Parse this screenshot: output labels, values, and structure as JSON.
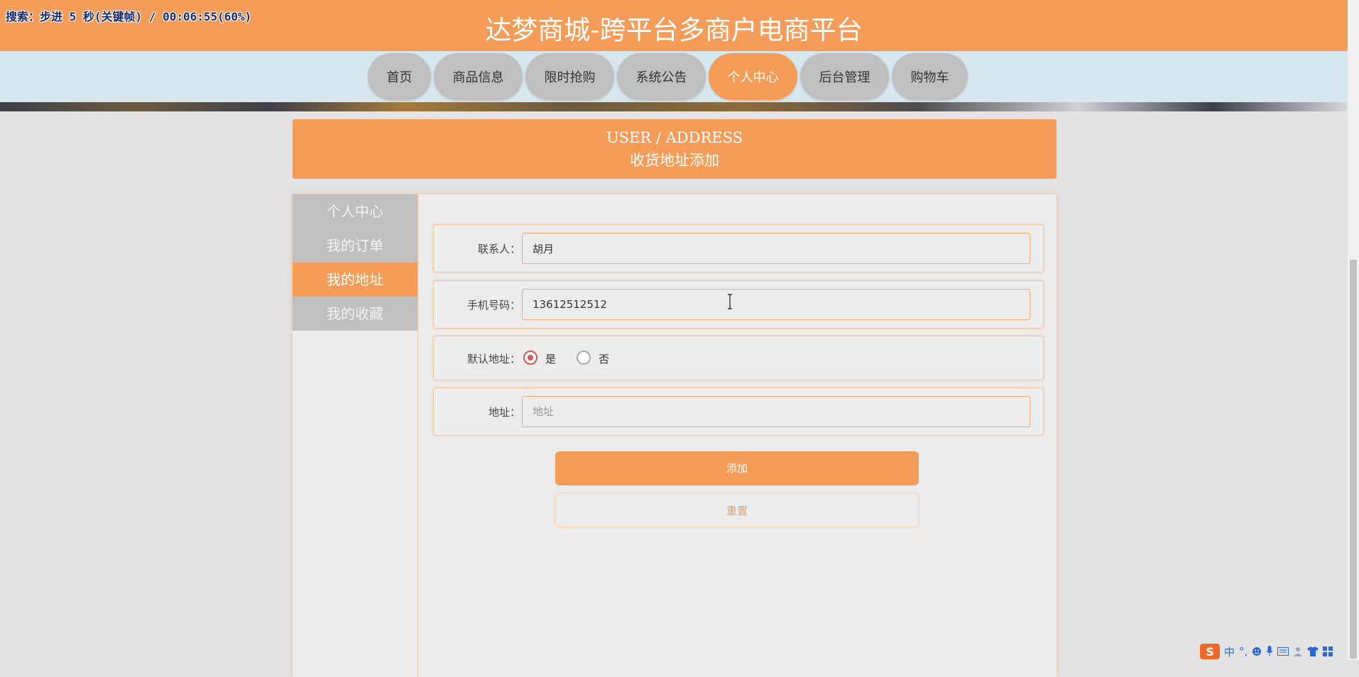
{
  "overlay": "搜索：步进 5 秒(关键帧) / 00:06:55(60%)",
  "header": {
    "title": "达梦商城-跨平台多商户电商平台"
  },
  "nav": [
    {
      "label": "首页",
      "active": false
    },
    {
      "label": "商品信息",
      "active": false
    },
    {
      "label": "限时抢购",
      "active": false
    },
    {
      "label": "系统公告",
      "active": false
    },
    {
      "label": "个人中心",
      "active": true
    },
    {
      "label": "后台管理",
      "active": false
    },
    {
      "label": "购物车",
      "active": false
    }
  ],
  "heading": {
    "en": "USER / ADDRESS",
    "cn": "收货地址添加"
  },
  "side_menu": [
    {
      "label": "个人中心",
      "active": false
    },
    {
      "label": "我的订单",
      "active": false
    },
    {
      "label": "我的地址",
      "active": true
    },
    {
      "label": "我的收藏",
      "active": false
    }
  ],
  "form": {
    "contact": {
      "label": "联系人：",
      "value": "胡月"
    },
    "phone": {
      "label": "手机号码：",
      "value": "13612512512"
    },
    "default": {
      "label": "默认地址：",
      "yes": "是",
      "no": "否",
      "selected": "是"
    },
    "address": {
      "label": "地址：",
      "value": "",
      "placeholder": "地址"
    }
  },
  "buttons": {
    "add": "添加",
    "reset": "重置"
  },
  "ime": {
    "logo": "S",
    "lang": "中",
    "punct": "°,",
    "icons": [
      "smile-icon",
      "mic-icon",
      "keyboard-icon",
      "user-icon",
      "shirt-icon",
      "grid-icon"
    ]
  },
  "colors": {
    "accent": "#f59d58",
    "nav_bg": "#d6e7ee",
    "radio_checked": "#d9534f"
  }
}
